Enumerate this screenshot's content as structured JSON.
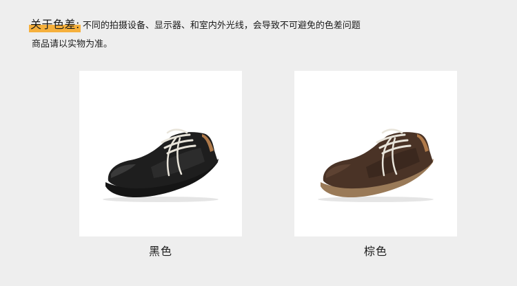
{
  "notice": {
    "label": "关于色差:",
    "text": "不同的拍摄设备、显示器、和室内外光线，会导致不可避免的色差问题",
    "text2": "商品请以实物为准。",
    "highlight_color": "#f6b03c"
  },
  "variants": [
    {
      "name": "黑色",
      "icon": "black-sneaker-image",
      "color": "#1c1c1c"
    },
    {
      "name": "棕色",
      "icon": "brown-sneaker-image",
      "color": "#4a3326"
    }
  ]
}
